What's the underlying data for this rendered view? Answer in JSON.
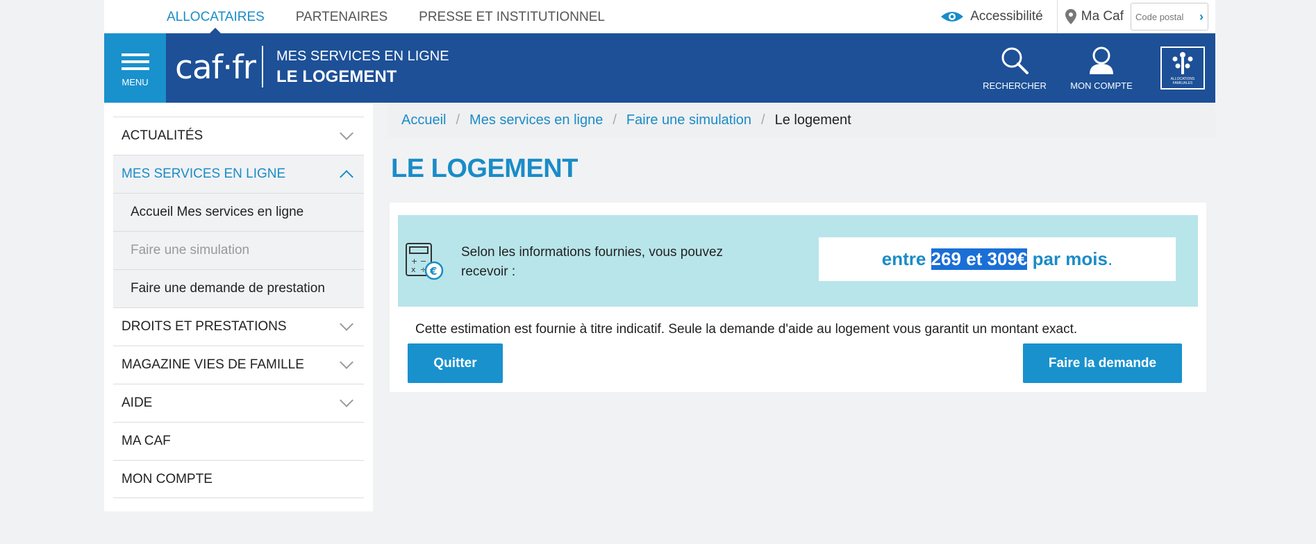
{
  "topnav": {
    "items": [
      {
        "label": "ALLOCATAIRES",
        "active": true
      },
      {
        "label": "PARTENAIRES",
        "active": false
      },
      {
        "label": "PRESSE ET INSTITUTIONNEL",
        "active": false
      }
    ],
    "accessibility": "Accessibilité",
    "ma_caf": "Ma Caf",
    "postal_placeholder": "Code postal"
  },
  "header": {
    "menu_label": "MENU",
    "logo": "caf·fr",
    "subtitle": "MES SERVICES EN LIGNE",
    "title": "LE LOGEMENT",
    "search_label": "RECHERCHER",
    "account_label": "MON COMPTE",
    "badge_text": "ALLOCATIONS FAMILIALES"
  },
  "sidebar": {
    "items": [
      {
        "label": "ACTUALITÉS"
      },
      {
        "label": "MES SERVICES EN LIGNE"
      },
      {
        "label": "DROITS ET PRESTATIONS"
      },
      {
        "label": "MAGAZINE VIES DE FAMILLE"
      },
      {
        "label": "AIDE"
      },
      {
        "label": "MA CAF"
      },
      {
        "label": "MON COMPTE"
      }
    ],
    "subitems": [
      {
        "label": "Accueil Mes services en ligne"
      },
      {
        "label": "Faire une simulation"
      },
      {
        "label": "Faire une demande de prestation"
      }
    ]
  },
  "breadcrumb": {
    "items": [
      "Accueil",
      "Mes services en ligne",
      "Faire une simulation"
    ],
    "current": "Le logement"
  },
  "main": {
    "title": "LE LOGEMENT",
    "result_text": "Selon les informations fournies, vous pouvez recevoir :",
    "amount_prefix": "entre ",
    "amount_highlight": "269 et 309€",
    "amount_suffix": " par mois",
    "amount_end": ".",
    "disclaimer": "Cette estimation est fournie à titre indicatif. Seule la demande d'aide au logement vous garantit un montant exact.",
    "quit_label": "Quitter",
    "submit_label": "Faire la demande"
  },
  "colors": {
    "header_blue": "#1d5097",
    "accent_blue": "#1991cd",
    "link_blue": "#1a8cc7",
    "result_bg": "#b8e5ea"
  }
}
